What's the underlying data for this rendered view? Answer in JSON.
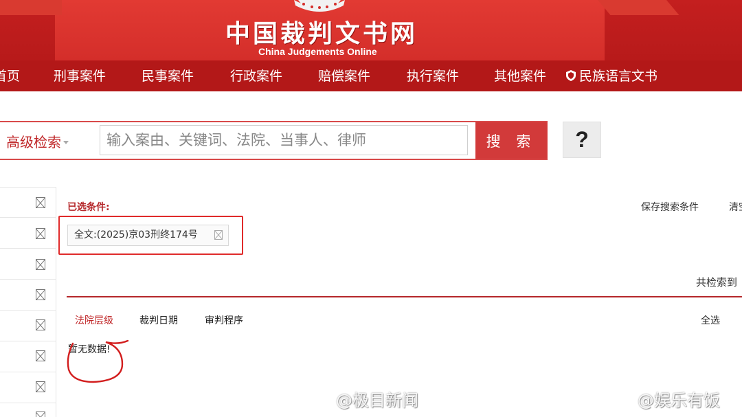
{
  "header": {
    "site_title": "中国裁判文书网",
    "site_subtitle": "China Judgements Online"
  },
  "nav": {
    "items": [
      {
        "label": "首页"
      },
      {
        "label": "刑事案件"
      },
      {
        "label": "民事案件"
      },
      {
        "label": "行政案件"
      },
      {
        "label": "赔偿案件"
      },
      {
        "label": "执行案件"
      },
      {
        "label": "其他案件"
      },
      {
        "label": "民族语言文书",
        "icon": "shield-icon"
      }
    ]
  },
  "search": {
    "advanced_label": "高级检索",
    "placeholder": "输入案由、关键词、法院、当事人、律师",
    "button_label": "搜 索",
    "help_label": "?"
  },
  "conditions": {
    "label": "已选条件:",
    "save_label": "保存搜索条件",
    "clear_label": "清空",
    "chip_text": "全文:(2025)京03刑终174号"
  },
  "results": {
    "total_label": "共检索到",
    "tabs": [
      {
        "label": "法院层级",
        "active": true
      },
      {
        "label": "裁判日期",
        "active": false
      },
      {
        "label": "审判程序",
        "active": false
      }
    ],
    "select_all": "全选",
    "empty_text": "暂无数据!"
  },
  "watermarks": {
    "left": "@极目新闻",
    "right": "@娱乐有饭"
  },
  "colors": {
    "brand_red": "#b31818",
    "header_red": "#d42e2a",
    "accent_red": "#c0282a",
    "search_button": "#d23a3a",
    "highlight_frame": "#e02a2a"
  }
}
